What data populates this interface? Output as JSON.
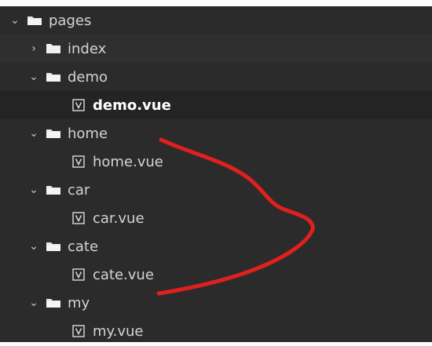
{
  "tree": {
    "rows": [
      {
        "label": "pages",
        "type": "folder",
        "expanded": true,
        "level": 0
      },
      {
        "label": "index",
        "type": "folder",
        "expanded": false,
        "level": 1
      },
      {
        "label": "demo",
        "type": "folder",
        "expanded": true,
        "level": 1
      },
      {
        "label": "demo.vue",
        "type": "file",
        "level": 2,
        "selected": true
      },
      {
        "label": "home",
        "type": "folder",
        "expanded": true,
        "level": 1
      },
      {
        "label": "home.vue",
        "type": "file",
        "level": 2
      },
      {
        "label": "car",
        "type": "folder",
        "expanded": true,
        "level": 1
      },
      {
        "label": "car.vue",
        "type": "file",
        "level": 2
      },
      {
        "label": "cate",
        "type": "folder",
        "expanded": true,
        "level": 1
      },
      {
        "label": "cate.vue",
        "type": "file",
        "level": 2
      },
      {
        "label": "my",
        "type": "folder",
        "expanded": true,
        "level": 1
      },
      {
        "label": "my.vue",
        "type": "file",
        "level": 2
      }
    ]
  },
  "colors": {
    "background": "#2b2b2b",
    "text": "#d4d4d4",
    "annotation_stroke": "#e0201e"
  }
}
